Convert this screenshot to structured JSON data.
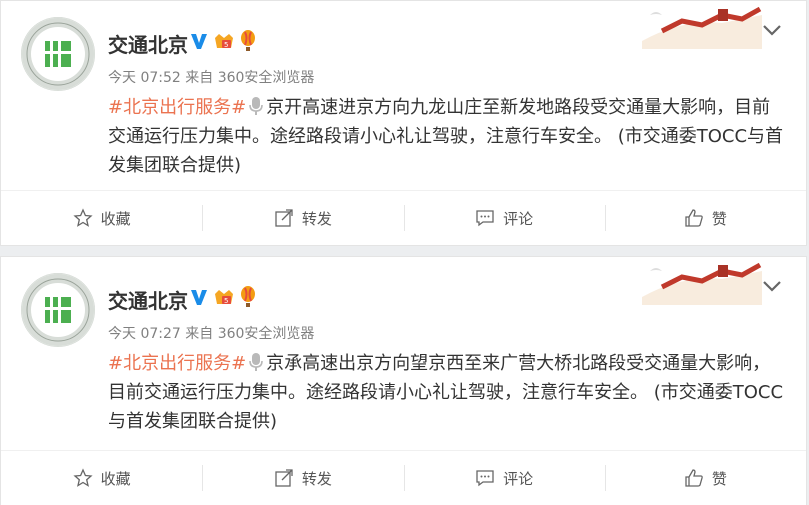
{
  "posts": [
    {
      "author": "交通北京",
      "time": "今天 07:52",
      "source": "来自 360安全浏览器",
      "topic": "#北京出行服务#",
      "text": "京开高速进京方向九龙山庄至新发地路段受交通量大影响，目前交通运行压力集中。途经路段请小心礼让驾驶，注意行车安全。 (市交通委TOCC与首发集团联合提供)",
      "actions": [
        "收藏",
        "转发",
        "评论",
        "赞"
      ]
    },
    {
      "author": "交通北京",
      "time": "今天 07:27",
      "source": "来自 360安全浏览器",
      "topic": "#北京出行服务#",
      "text": "京承高速出京方向望京西至来广营大桥北路段受交通量大影响，目前交通运行压力集中。途经路段请小心礼让驾驶，注意行车安全。 (市交通委TOCC与首发集团联合提供)",
      "actions": [
        "收藏",
        "转发",
        "评论",
        "赞"
      ]
    }
  ],
  "colors": {
    "topic": "#eb7350",
    "verified": "#1a8ce8"
  },
  "icons": {
    "verified": "verified-v-icon",
    "member": "member-badge-icon",
    "balloon": "balloon-icon",
    "mic": "microphone-icon",
    "great_wall": "great-wall-decoration",
    "expand": "chevron-down-icon",
    "favorite": "star-icon",
    "forward": "forward-icon",
    "comment": "comment-icon",
    "like": "thumbs-up-icon"
  }
}
